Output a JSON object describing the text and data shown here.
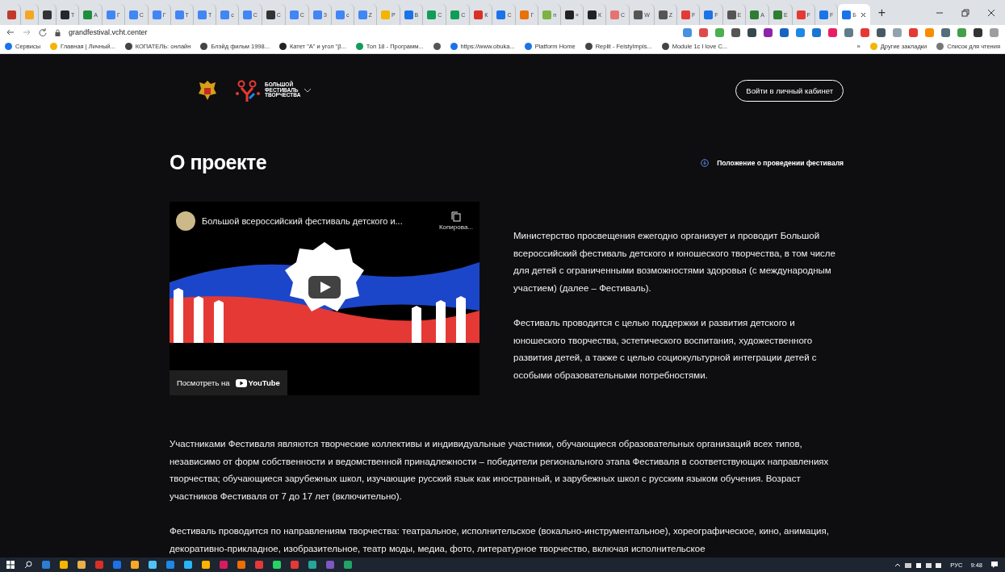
{
  "browser": {
    "tabs": [
      {
        "color": "#c0392b",
        "selected": false
      },
      {
        "color": "#f5a623",
        "selected": false
      },
      {
        "color": "#333333",
        "selected": false
      },
      {
        "label": "Т",
        "color": "#24292e",
        "selected": false
      },
      {
        "label": "А",
        "color": "#1e8e3e",
        "selected": false
      },
      {
        "label": "Г",
        "color": "#4285f4",
        "selected": false
      },
      {
        "label": "С",
        "color": "#4285f4",
        "selected": false
      },
      {
        "label": "Г",
        "color": "#4285f4",
        "selected": false
      },
      {
        "label": "Т",
        "color": "#4285f4",
        "selected": false
      },
      {
        "label": "Т",
        "color": "#4285f4",
        "selected": false
      },
      {
        "label": "с",
        "color": "#4285f4",
        "selected": false
      },
      {
        "label": "С",
        "color": "#4285f4",
        "selected": false
      },
      {
        "label": "С",
        "color": "#333333",
        "selected": false
      },
      {
        "label": "С",
        "color": "#4285f4",
        "selected": false
      },
      {
        "label": "З",
        "color": "#4285f4",
        "selected": false
      },
      {
        "label": "с",
        "color": "#4285f4",
        "selected": false
      },
      {
        "label": "Z",
        "color": "#4285f4",
        "selected": false
      },
      {
        "label": "Р",
        "color": "#f4b400",
        "selected": false
      },
      {
        "label": "В",
        "color": "#1a73e8",
        "selected": false
      },
      {
        "label": "С",
        "color": "#0f9d58",
        "selected": false
      },
      {
        "label": "С",
        "color": "#0f9d58",
        "selected": false
      },
      {
        "label": "К",
        "color": "#d93025",
        "selected": false
      },
      {
        "label": "С",
        "color": "#1a73e8",
        "selected": false
      },
      {
        "label": "Г",
        "color": "#e8710a",
        "selected": false
      },
      {
        "label": "п",
        "color": "#7cb342",
        "selected": false
      },
      {
        "label": "«",
        "color": "#222222",
        "selected": false
      },
      {
        "label": "К",
        "color": "#222222",
        "selected": false
      },
      {
        "label": "С",
        "color": "#e57373",
        "selected": false
      },
      {
        "label": "W",
        "color": "#555555",
        "selected": false
      },
      {
        "label": "Z",
        "color": "#555555",
        "selected": false
      },
      {
        "label": "F",
        "color": "#e53935",
        "selected": false
      },
      {
        "label": "F",
        "color": "#1a73e8",
        "selected": false
      },
      {
        "label": "Е",
        "color": "#555555",
        "selected": false
      },
      {
        "label": "А",
        "color": "#2e7d32",
        "selected": false
      },
      {
        "label": "Е",
        "color": "#2e7d32",
        "selected": false
      },
      {
        "label": "F",
        "color": "#e53935",
        "selected": false
      },
      {
        "label": "F",
        "color": "#1a73e8",
        "selected": false
      },
      {
        "label": "Б",
        "color": "#1a73e8",
        "selected": true
      }
    ],
    "new_tab": "+",
    "url": "grandfestival.vcht.center",
    "bookmarks": [
      {
        "kind": "link",
        "label": "Сервисы"
      },
      {
        "kind": "link",
        "label": "Главная | Личный..."
      },
      {
        "kind": "link",
        "label": "КОПАТЕЛЬ: онлайн"
      },
      {
        "kind": "link",
        "label": "Блэйд фильм 1998..."
      },
      {
        "kind": "link",
        "label": "Катет \"А\" и угол \"β..."
      },
      {
        "kind": "link",
        "label": "Топ 18 - Программ..."
      },
      {
        "kind": "icon"
      },
      {
        "kind": "link",
        "label": "https://www.obuka..."
      },
      {
        "kind": "link",
        "label": "Platform Home"
      },
      {
        "kind": "link",
        "label": "Replit - FeistyImpis..."
      },
      {
        "kind": "link",
        "label": "Module 1c I love C..."
      }
    ],
    "more": "»",
    "other_bookmarks": "Другие закладки",
    "reading_list": "Список для чтения"
  },
  "header": {
    "logo_lines": [
      "БОЛЬШОЙ",
      "ФЕСТИВАЛЬ",
      "ТВОРЧЕСТВА"
    ],
    "login": "Войти в личный кабинет"
  },
  "title": "О проекте",
  "doc_link": "Положение о проведении фестиваля",
  "video": {
    "title": "Большой всероссийский фестиваль детского и...",
    "copy": "Копирова...",
    "watch_on": "Посмотреть на",
    "youtube": "YouTube"
  },
  "intro": [
    "Министерство просвещения ежегодно организует и проводит Большой всероссийский фестиваль детского и юношеского творчества, в том числе для детей с ограниченными возможностями здоровья (с международным участием) (далее – Фестиваль).",
    "Фестиваль проводится с целью поддержки и развития детского и юношеского творчества, эстетического воспитания, художественного развития детей, а также с целью социокультурной интеграции детей с особыми образовательными потребностями."
  ],
  "body": [
    "Участниками Фестиваля являются творческие коллективы и индивидуальные участники, обучающиеся образовательных организаций всех типов, независимо от форм собственности и ведомственной принадлежности – победители регионального этапа Фестиваля в соответствующих направлениях творчества; обучающиеся зарубежных школ, изучающие русский язык как иностранный, и зарубежных школ с русским языком обучения. Возраст участников Фестиваля от 7 до 17 лет (включительно).",
    "Фестиваль проводится по направлениям творчества: театральное, исполнительское (вокально-инструментальное), хореографическое, кино, анимация, декоративно-прикладное, изобразительное, театр моды, медиа, фото, литературное творчество, включая исполнительское"
  ],
  "taskbar": {
    "lang": "РУС",
    "time": "9:48"
  }
}
